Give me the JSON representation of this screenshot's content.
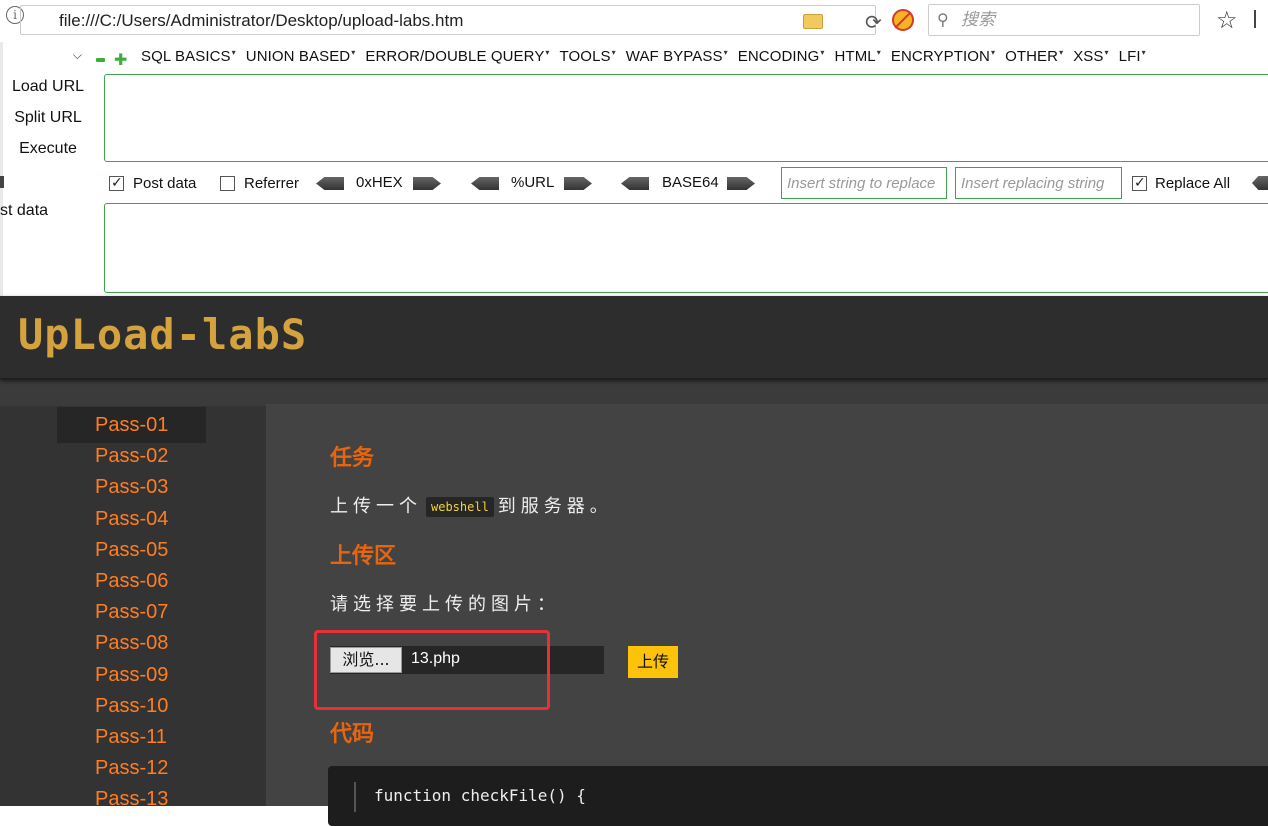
{
  "browser": {
    "url": "file:///C:/Users/Administrator/Desktop/upload-labs.htm",
    "search_placeholder": "搜索",
    "info_icon": "info-icon",
    "folder_icon": "folder-icon",
    "reload_icon": "reload-icon",
    "noscript_icon": "noscript-icon",
    "star_icon": "bookmark-star-icon"
  },
  "hackbar": {
    "menu": [
      "SQL BASICS",
      "UNION BASED",
      "ERROR/DOUBLE QUERY",
      "TOOLS",
      "WAF BYPASS",
      "ENCODING",
      "HTML",
      "ENCRYPTION",
      "OTHER",
      "XSS",
      "LFI"
    ],
    "load_url": "Load URL",
    "split_url": "Split URL",
    "execute": "Execute",
    "post_data": "Post data",
    "referrer": "Referrer",
    "hex": "0xHEX",
    "url_enc": "%URL",
    "base64": "BASE64",
    "replace_placeholder": "Insert string to replace",
    "replacing_placeholder": "Insert replacing string",
    "replace_all": "Replace All",
    "post_label": "st data",
    "post_data_checked": true,
    "referrer_checked": false,
    "replace_all_checked": true
  },
  "site": {
    "logo": "UpLoad-labS",
    "passes": [
      "Pass-01",
      "Pass-02",
      "Pass-03",
      "Pass-04",
      "Pass-05",
      "Pass-06",
      "Pass-07",
      "Pass-08",
      "Pass-09",
      "Pass-10",
      "Pass-11",
      "Pass-12",
      "Pass-13"
    ],
    "active_pass": "Pass-01",
    "task_heading": "任务",
    "task_before": "上传一个",
    "task_code": "webshell",
    "task_after": "到服务器。",
    "upload_heading": "上传区",
    "upload_prompt": "请选择要上传的图片：",
    "browse": "浏览...",
    "file_name": "13.php",
    "upload_button": "上传",
    "code_heading": "代码",
    "code_line": "function checkFile() {",
    "accent_color": "#e8650f",
    "highlight_color": "#e8303a"
  }
}
